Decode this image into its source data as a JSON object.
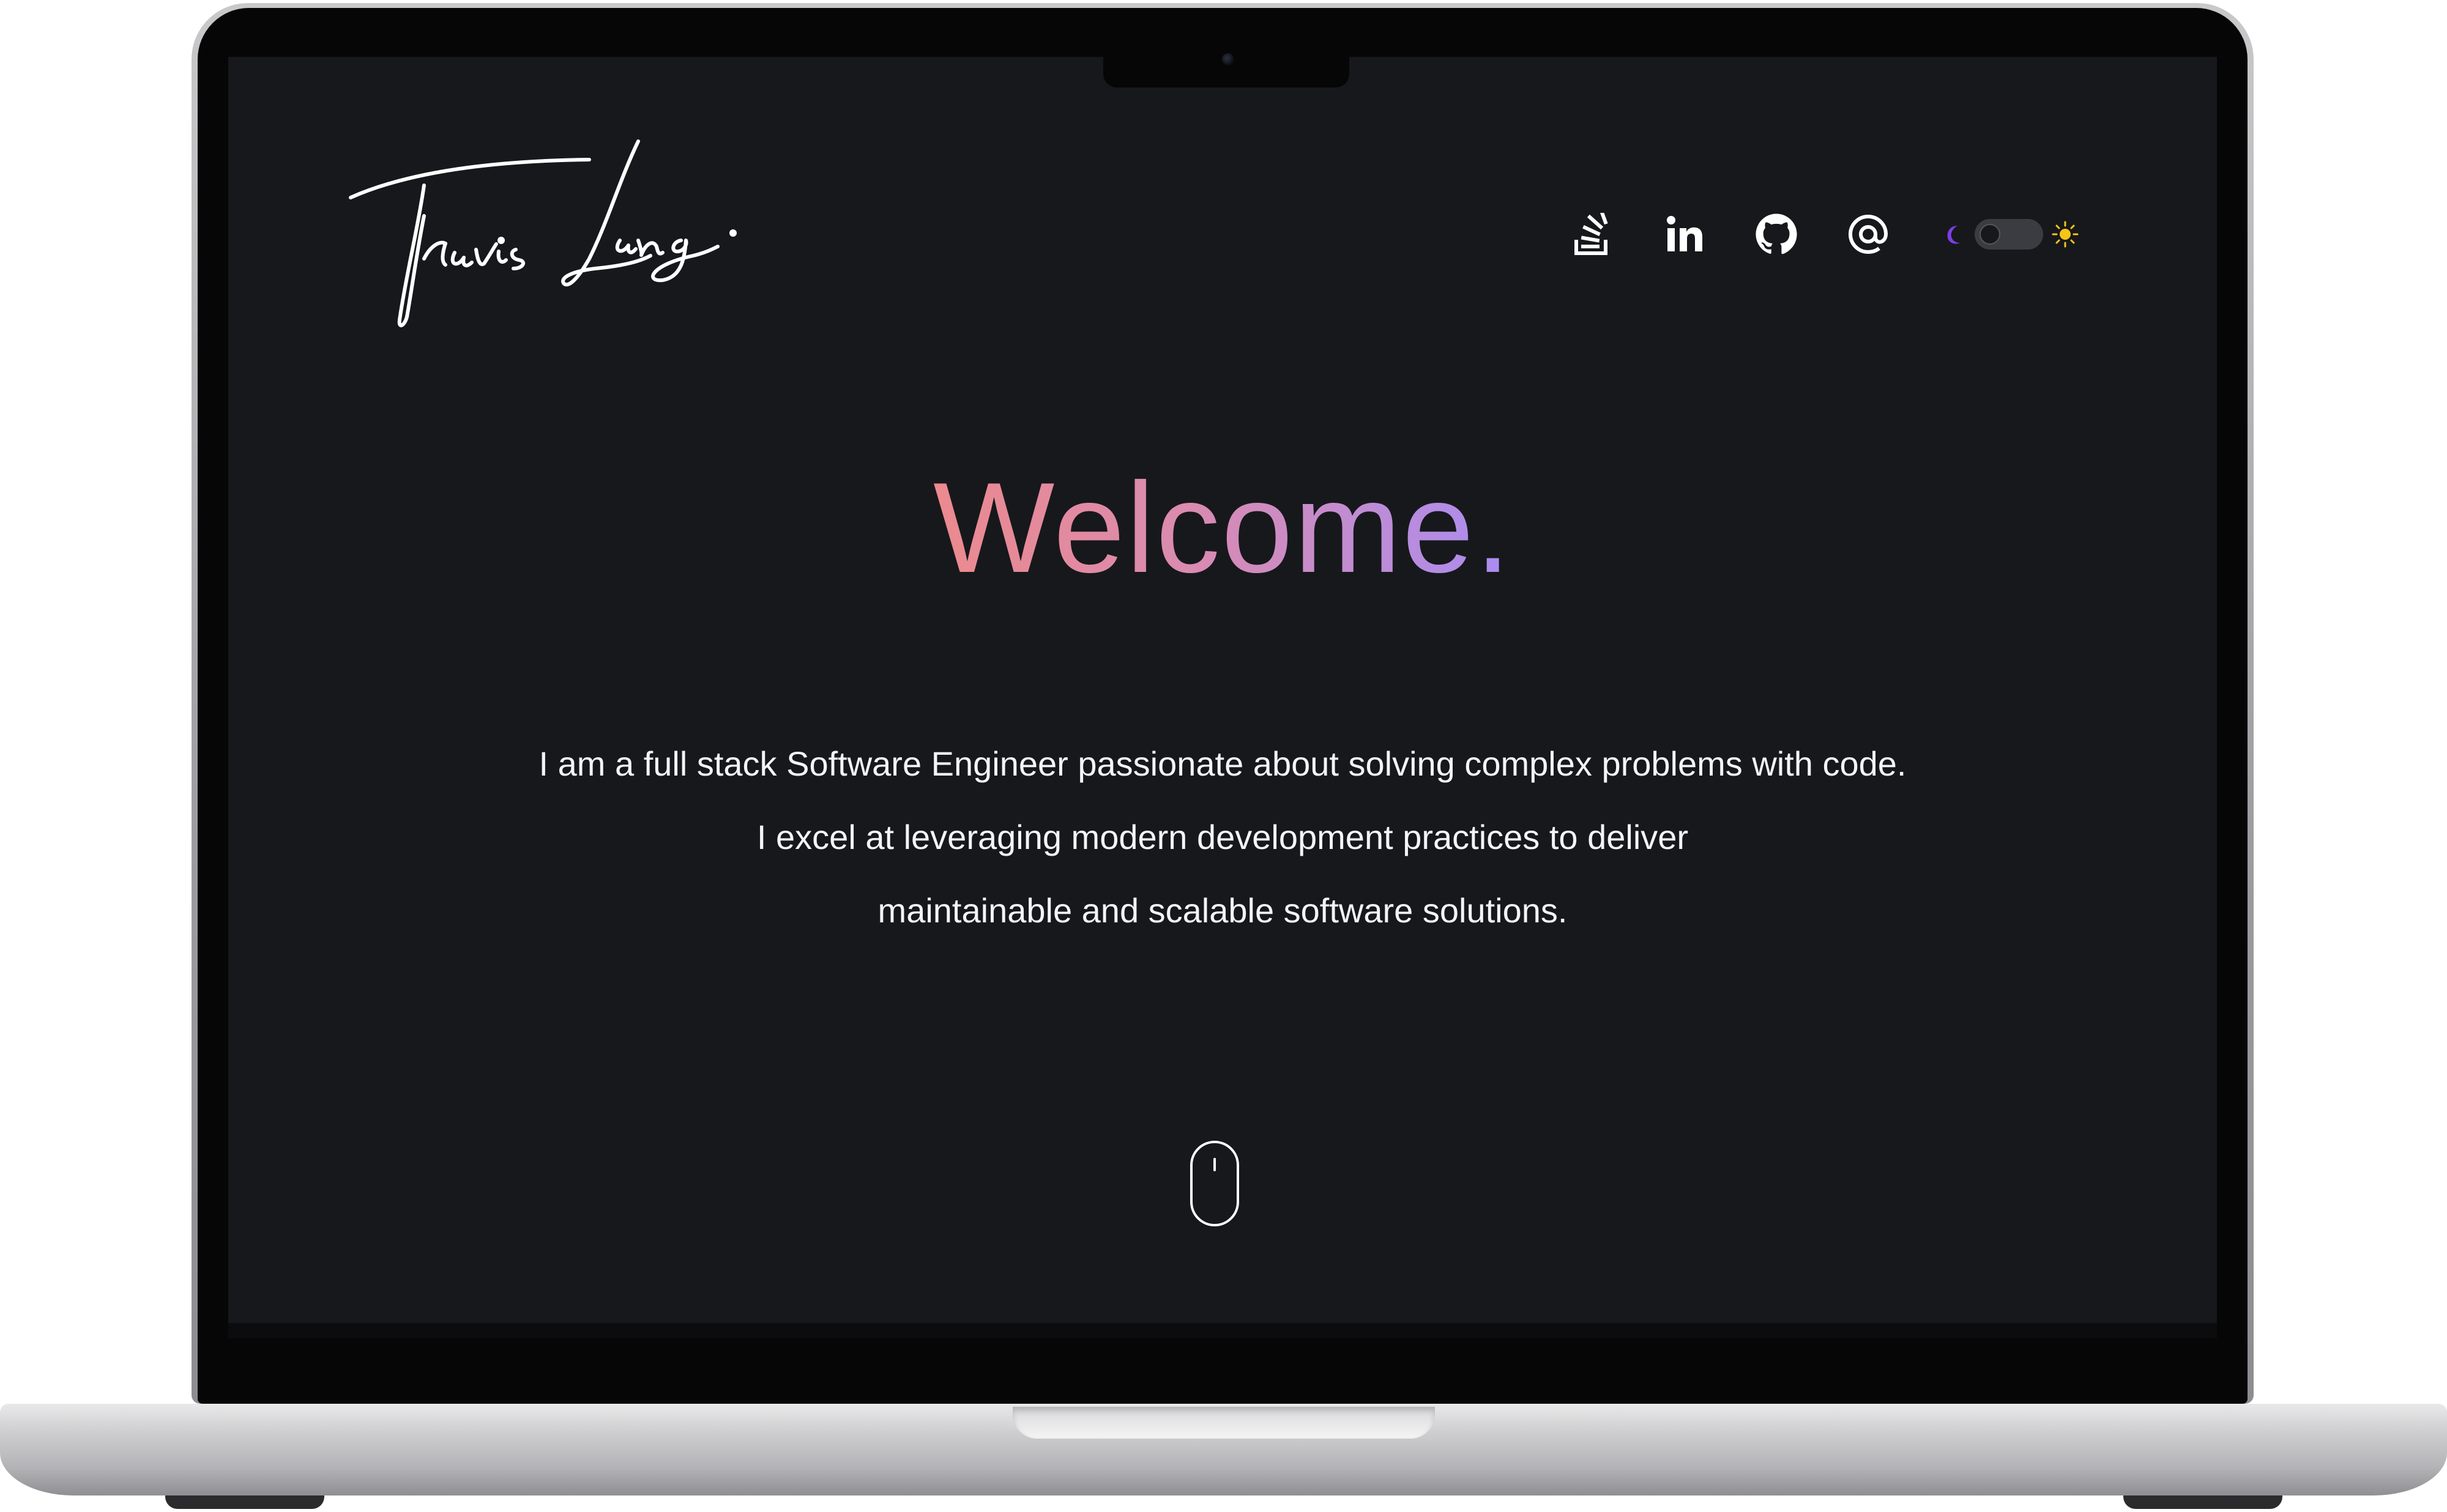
{
  "site": {
    "logo_text": "Travis Lang.",
    "colors": {
      "background": "#17181c",
      "text": "#f4f4f6",
      "gradient_start": "#ec8a8e",
      "gradient_mid": "#d98bb1",
      "gradient_end": "#a98df2",
      "moon": "#7b3fe4",
      "sun": "#f5c518"
    }
  },
  "header": {
    "social_links": [
      {
        "icon": "stack-overflow-icon"
      },
      {
        "icon": "linkedin-icon"
      },
      {
        "icon": "github-icon"
      },
      {
        "icon": "email-at-icon"
      }
    ],
    "theme_toggle": {
      "left_icon": "moon-icon",
      "right_icon": "sun-icon",
      "state": "dark"
    }
  },
  "hero": {
    "title": "Welcome.",
    "lines": [
      "I am a full stack Software Engineer passionate about solving complex problems with code.",
      "I excel at leveraging modern development practices to deliver",
      "maintainable and scalable software solutions."
    ],
    "scroll_indicator": "mouse-scroll-icon"
  }
}
